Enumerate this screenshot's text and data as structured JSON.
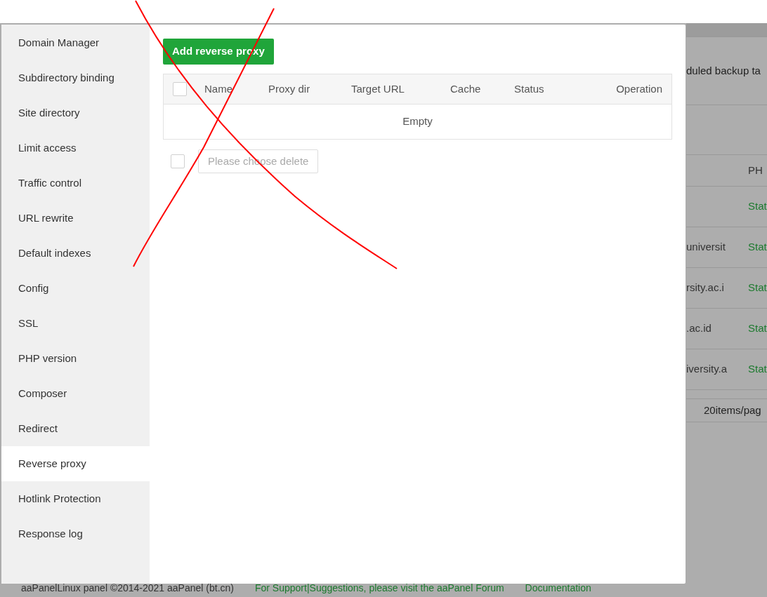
{
  "sidebar": {
    "items": [
      {
        "label": "Domain Manager",
        "selected": false
      },
      {
        "label": "Subdirectory binding",
        "selected": false
      },
      {
        "label": "Site directory",
        "selected": false
      },
      {
        "label": "Limit access",
        "selected": false
      },
      {
        "label": "Traffic control",
        "selected": false
      },
      {
        "label": "URL rewrite",
        "selected": false
      },
      {
        "label": "Default indexes",
        "selected": false
      },
      {
        "label": "Config",
        "selected": false
      },
      {
        "label": "SSL",
        "selected": false
      },
      {
        "label": "PHP version",
        "selected": false
      },
      {
        "label": "Composer",
        "selected": false
      },
      {
        "label": "Redirect",
        "selected": false
      },
      {
        "label": "Reverse proxy",
        "selected": true
      },
      {
        "label": "Hotlink Protection",
        "selected": false
      },
      {
        "label": "Response log",
        "selected": false
      }
    ]
  },
  "add_button": "Add reverse proxy",
  "proxy_table": {
    "select_all": {
      "checked": false
    },
    "columns": [
      "Name",
      "Proxy dir",
      "Target URL",
      "Cache",
      "Status",
      "Operation"
    ],
    "empty_text": "Empty"
  },
  "batch_bar": {
    "checkbox": {
      "checked": false
    },
    "delete_button": {
      "label": "Please choose delete",
      "disabled": true
    }
  },
  "background": {
    "notice": "duled backup ta",
    "column_header": "PH",
    "rows": [
      {
        "status": "Stat"
      },
      {
        "domain": "universit",
        "status": "Stat"
      },
      {
        "domain": "rsity.ac.i",
        "status": "Stat"
      },
      {
        "domain": ".ac.id",
        "status": "Stat"
      },
      {
        "domain": "iversity.a",
        "status": "Stat"
      }
    ],
    "page_size": "20items/pag"
  },
  "footer": {
    "copyright": "aaPanelLinux panel ©2014-2021 aaPanel (bt.cn)",
    "support_link": "For Support|Suggestions, please visit the aaPanel Forum",
    "docs_link": "Documentation"
  }
}
